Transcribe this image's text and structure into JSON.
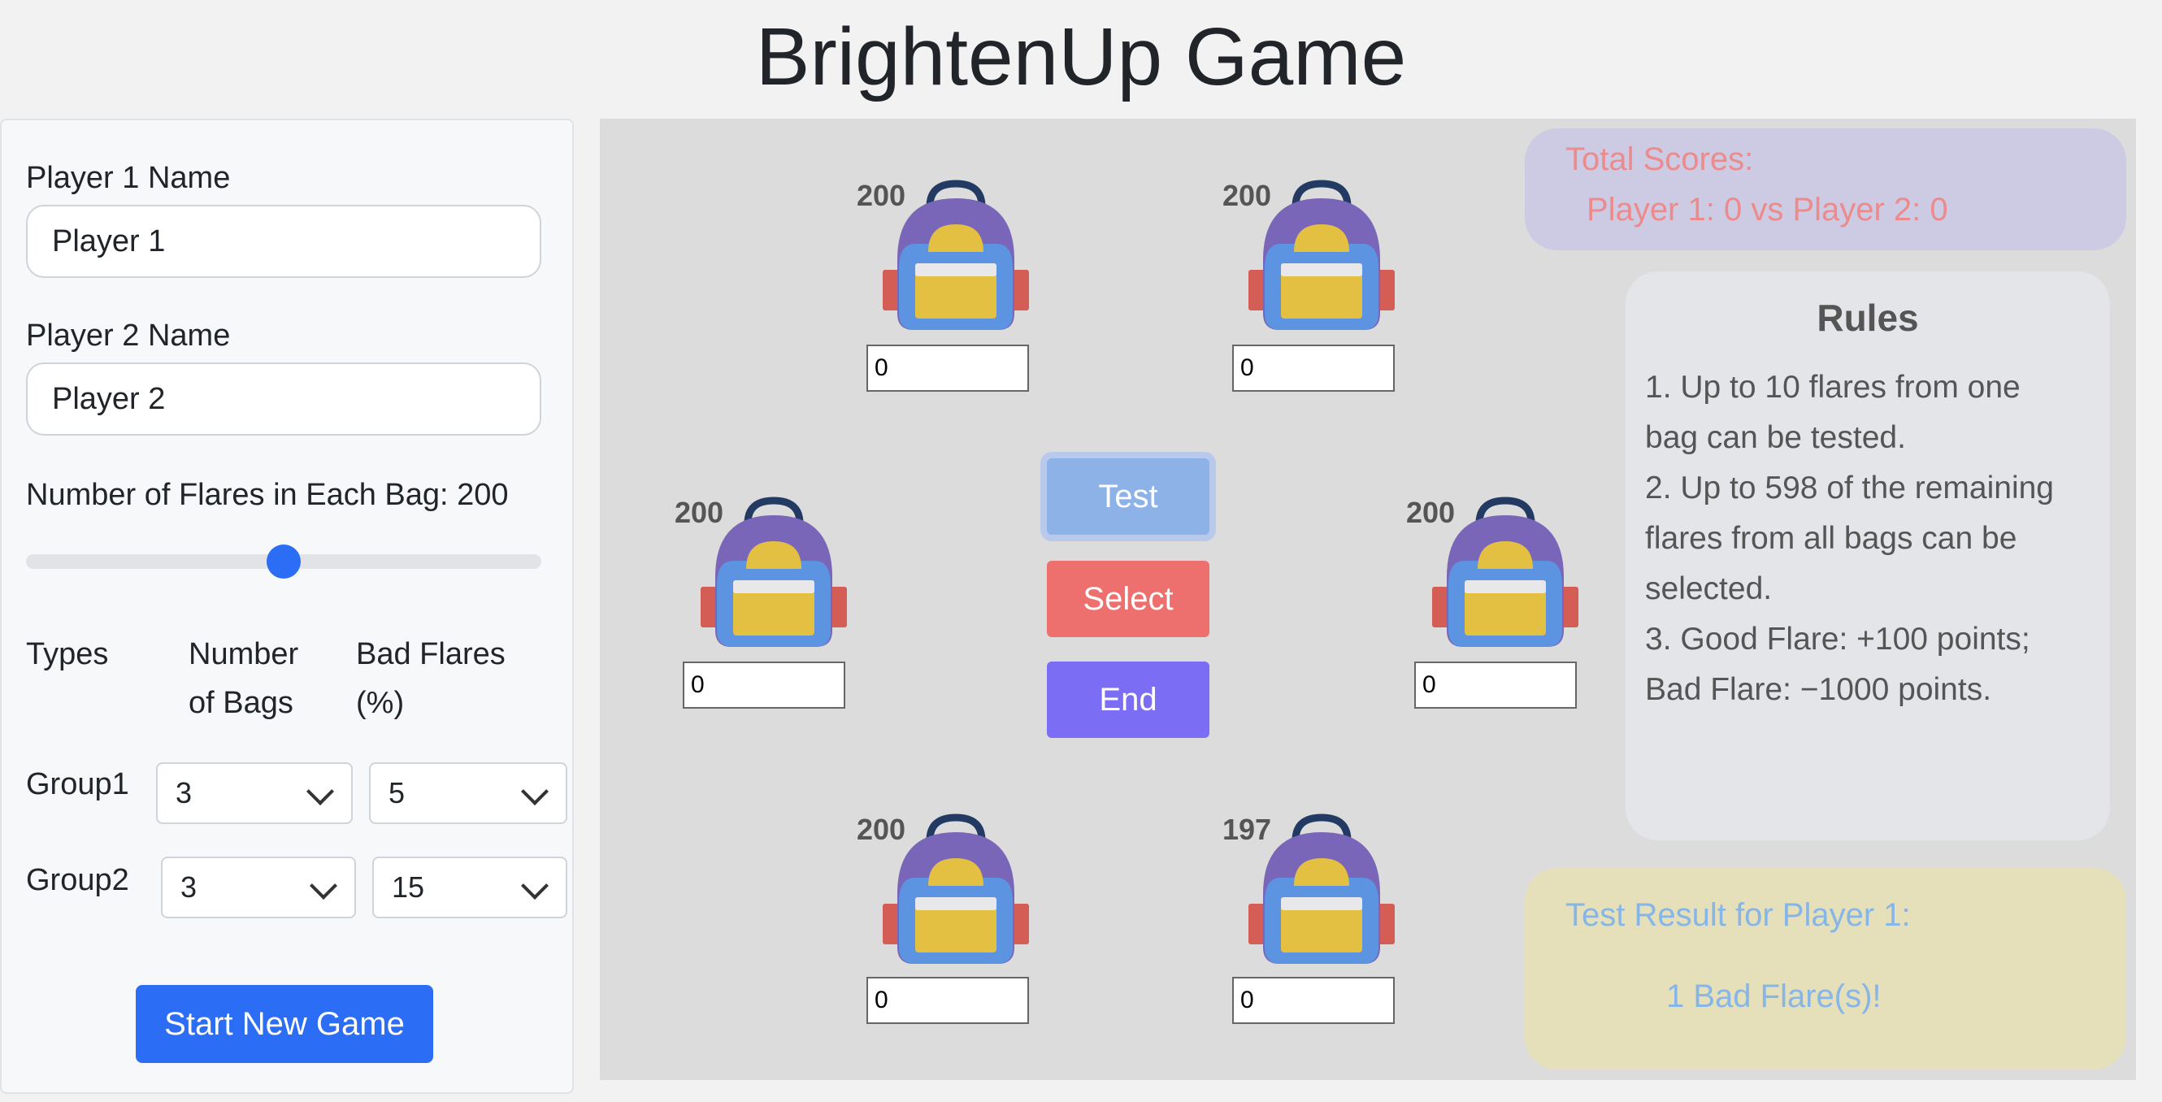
{
  "title": "BrightenUp Game",
  "settings": {
    "player1_label": "Player 1 Name",
    "player1_value": "Player 1",
    "player2_label": "Player 2 Name",
    "player2_value": "Player 2",
    "flares_label": "Number of Flares in Each Bag: 200",
    "flares_slider_fraction": 0.5,
    "col_types": "Types",
    "col_bags_1": "Number",
    "col_bags_2": "of Bags",
    "col_bad_1": "Bad Flares",
    "col_bad_2": "(%)",
    "groups": [
      {
        "name": "Group1",
        "bags": "3",
        "bad": "5"
      },
      {
        "name": "Group2",
        "bags": "3",
        "bad": "15"
      }
    ],
    "start_button": "Start New Game"
  },
  "bags": [
    {
      "count": "200",
      "input": "0"
    },
    {
      "count": "200",
      "input": "0"
    },
    {
      "count": "200",
      "input": "0"
    },
    {
      "count": "200",
      "input": "0"
    },
    {
      "count": "200",
      "input": "0"
    },
    {
      "count": "197",
      "input": "0"
    }
  ],
  "actions": {
    "test": "Test",
    "select": "Select",
    "end": "End"
  },
  "scores": {
    "title": "Total Scores:",
    "line": "Player 1: 0 vs Player 2: 0"
  },
  "rules": {
    "title": "Rules",
    "lines": [
      "1. Up to 10 flares from one",
      "bag can be tested.",
      "2. Up to 598 of the remaining",
      "flares from all bags can be",
      "selected.",
      "3. Good Flare: +100 points;",
      "Bad Flare: −1000 points."
    ]
  },
  "result": {
    "title": "Test Result for Player 1:",
    "message": "1 Bad Flare(s)!"
  },
  "colors": {
    "accent": "#2c6df5",
    "select": "#ee706e",
    "end": "#7c6df5",
    "test": "#8db2e8"
  }
}
